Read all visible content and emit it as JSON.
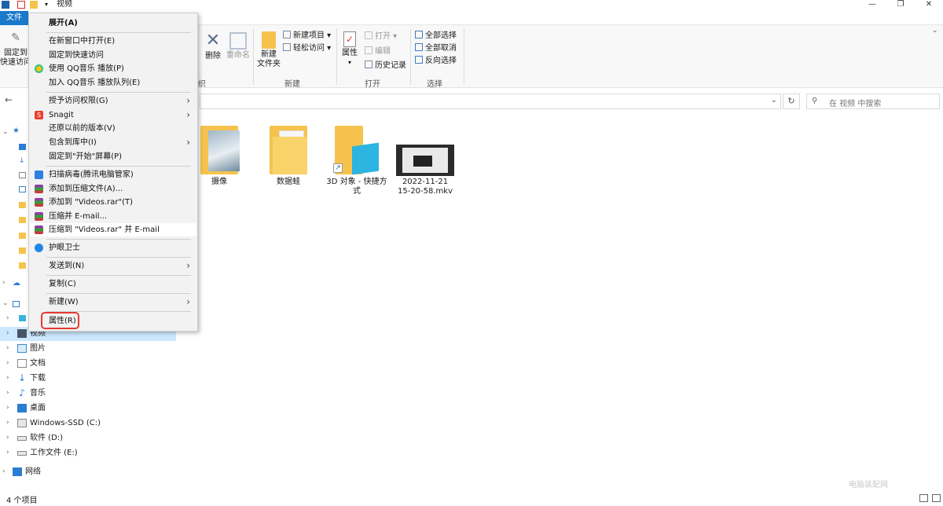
{
  "window": {
    "title": "视频",
    "controls": [
      "minimize",
      "maximize",
      "close"
    ]
  },
  "tabs": {
    "file": "文件"
  },
  "ribbon": {
    "pin": {
      "line1": "固定到",
      "line2": "快速访问"
    },
    "delete": "删除",
    "rename": "重命名",
    "organize_group_partial": "组织",
    "new_folder": {
      "line1": "新建",
      "line2": "文件夹"
    },
    "new_item": "新建项目",
    "easy_access": "轻松访问",
    "new_group": "新建",
    "properties": "属性",
    "open": "打开",
    "edit": "编辑",
    "history": "历史记录",
    "open_group": "打开",
    "select_all": "全部选择",
    "select_none": "全部取消",
    "invert_selection": "反向选择",
    "select_group": "选择"
  },
  "search": {
    "placeholder": "在 视频 中搜索"
  },
  "sidebar": {
    "items": [
      {
        "label": "视频",
        "icon": "video-library-icon",
        "selected": true
      },
      {
        "label": "图片",
        "icon": "pictures-icon"
      },
      {
        "label": "文档",
        "icon": "documents-icon"
      },
      {
        "label": "下载",
        "icon": "download-icon"
      },
      {
        "label": "音乐",
        "icon": "music-icon"
      },
      {
        "label": "桌面",
        "icon": "desktop-icon"
      },
      {
        "label": "Windows-SSD (C:)",
        "icon": "drive-c-icon"
      },
      {
        "label": "软件 (D:)",
        "icon": "drive-icon"
      },
      {
        "label": "工作文件 (E:)",
        "icon": "drive-icon"
      },
      {
        "label": "网络",
        "icon": "network-icon"
      }
    ]
  },
  "files": [
    {
      "name": "摄像",
      "type": "folder"
    },
    {
      "name": "数据蛙",
      "type": "folder"
    },
    {
      "name_line1": "3D 对象 - 快捷方",
      "name_line2": "式",
      "type": "shortcut"
    },
    {
      "name_line1": "2022-11-21",
      "name_line2": "15-20-58.mkv",
      "type": "video"
    }
  ],
  "context_menu": {
    "items": [
      {
        "label": "展开(A)"
      },
      {
        "label": "在新窗口中打开(E)"
      },
      {
        "label": "固定到快速访问"
      },
      {
        "label": "使用 QQ音乐 播放(P)"
      },
      {
        "label": "加入 QQ音乐 播放队列(E)"
      },
      {
        "label": "授予访问权限(G)"
      },
      {
        "label": "Snagit"
      },
      {
        "label": "还原以前的版本(V)"
      },
      {
        "label": "包含到库中(I)"
      },
      {
        "label": "固定到\"开始\"屏幕(P)"
      },
      {
        "label": "扫描病毒(腾讯电脑管家)"
      },
      {
        "label": "添加到压缩文件(A)..."
      },
      {
        "label": "添加到 \"Videos.rar\"(T)"
      },
      {
        "label": "压缩并 E-mail..."
      },
      {
        "label": "压缩到 \"Videos.rar\" 并 E-mail"
      },
      {
        "label": "护眼卫士"
      },
      {
        "label": "发送到(N)"
      },
      {
        "label": "复制(C)"
      },
      {
        "label": "新建(W)"
      },
      {
        "label": "属性(R)"
      }
    ]
  },
  "status": {
    "item_count": "4 个项目"
  },
  "watermark": "电脑装配网",
  "colors": {
    "accent": "#1979ca",
    "selection": "#cce8ff",
    "highlight_border": "#e53935",
    "folder": "#f5c34d"
  }
}
